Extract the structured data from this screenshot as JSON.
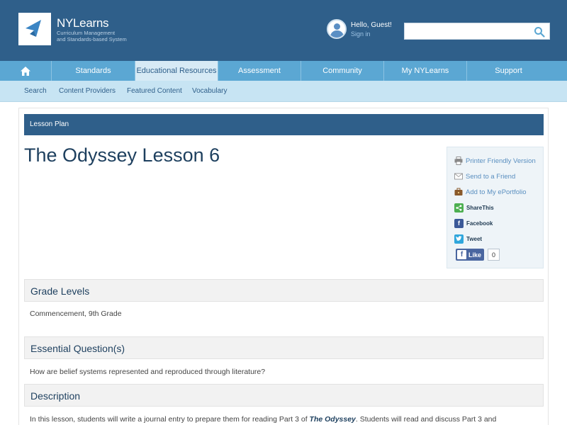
{
  "header": {
    "logo_name": "NYLearns",
    "logo_sub_line1": "Curriculum Management",
    "logo_sub_line2": "and Standards-based System",
    "greeting": "Hello, Guest!",
    "signin": "Sign in",
    "search_placeholder": "",
    "search_icon": "search-icon"
  },
  "nav": {
    "home_icon": "home-icon",
    "items": [
      "Standards",
      "Educational Resources",
      "Assessment",
      "Community",
      "My NYLearns",
      "Support"
    ],
    "active": "Educational Resources"
  },
  "subnav": {
    "items": [
      "Search",
      "Content Providers",
      "Featured Content",
      "Vocabulary"
    ]
  },
  "lesson_bar": "Lesson Plan",
  "title": "The Odyssey Lesson 6",
  "share_panel": {
    "printer": "Printer Friendly Version",
    "send": "Send to a Friend",
    "portfolio": "Add to My ePortfolio",
    "sharethis": "ShareThis",
    "facebook": "Facebook",
    "tweet": "Tweet",
    "like": "Like",
    "like_count": "0"
  },
  "sections": {
    "grade_levels": {
      "heading": "Grade Levels",
      "text": "Commencement, 9th Grade"
    },
    "essential_question": {
      "heading": "Essential Question(s)",
      "text": "How are belief systems represented and reproduced through literature?"
    },
    "description": {
      "heading": "Description",
      "text_before": "In this lesson, students will write a journal entry to prepare them for reading Part 3 of ",
      "text_em": "The Odyssey",
      "text_after": ". Students will read and discuss Part 3 and"
    }
  },
  "colors": {
    "header_bg": "#2f5f8a",
    "nav_bg": "#5ba7d3",
    "subnav_bg": "#c7e4f3",
    "active_tab": "#d7eaf5",
    "title_color": "#1d3f5e"
  }
}
